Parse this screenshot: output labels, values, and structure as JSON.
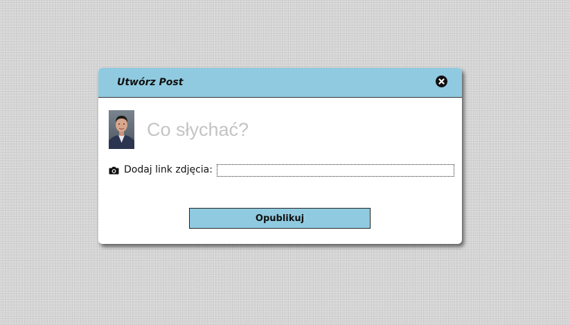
{
  "modal": {
    "title": "Utwórz Post",
    "close_icon": "close-circle-icon",
    "status_placeholder": "Co słychać?",
    "status_value": "",
    "avatar_icon": "user-avatar",
    "camera_icon": "camera-icon",
    "image_link_label": "Dodaj link zdjęcia:",
    "image_link_value": "",
    "publish_label": "Opublikuj"
  },
  "colors": {
    "header_bg": "#90cae0",
    "button_bg": "#90cae0",
    "page_bg": "#d6d6d6",
    "placeholder": "#c4c4c4"
  }
}
